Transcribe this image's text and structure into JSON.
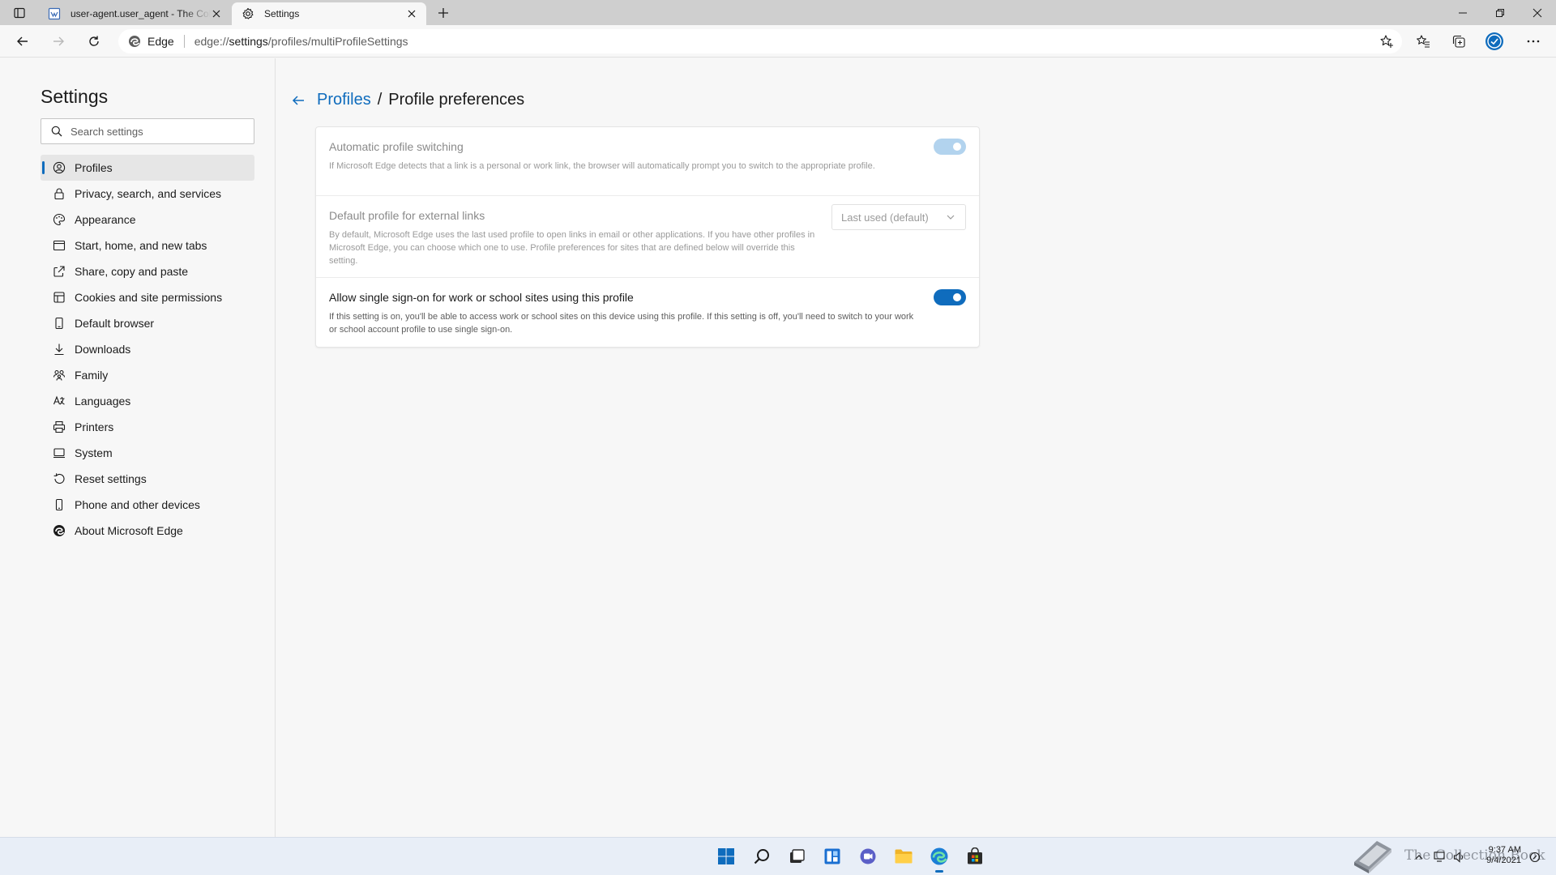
{
  "browser": {
    "tabs": [
      {
        "title": "user-agent.user_agent - The Collection Book",
        "icon": "web-document-icon",
        "active": false
      },
      {
        "title": "Settings",
        "icon": "gear-icon",
        "active": true
      }
    ],
    "window_controls": [
      "minimize-icon",
      "restore-icon",
      "close-icon"
    ],
    "toolbar": {
      "site_label": "Edge",
      "url_prefix": "edge://",
      "url_host": "settings",
      "url_path": "/profiles/multiProfileSettings"
    }
  },
  "sidebar": {
    "title": "Settings",
    "search_placeholder": "Search settings",
    "items": [
      {
        "label": "Profiles",
        "icon": "profile-icon",
        "active": true
      },
      {
        "label": "Privacy, search, and services",
        "icon": "lock-icon"
      },
      {
        "label": "Appearance",
        "icon": "appearance-icon"
      },
      {
        "label": "Start, home, and new tabs",
        "icon": "power-icon"
      },
      {
        "label": "Share, copy and paste",
        "icon": "share-icon"
      },
      {
        "label": "Cookies and site permissions",
        "icon": "cookies-icon"
      },
      {
        "label": "Default browser",
        "icon": "default-browser-icon"
      },
      {
        "label": "Downloads",
        "icon": "download-icon"
      },
      {
        "label": "Family",
        "icon": "family-icon"
      },
      {
        "label": "Languages",
        "icon": "languages-icon"
      },
      {
        "label": "Printers",
        "icon": "printer-icon"
      },
      {
        "label": "System",
        "icon": "system-icon"
      },
      {
        "label": "Reset settings",
        "icon": "reset-icon"
      },
      {
        "label": "Phone and other devices",
        "icon": "phone-icon"
      },
      {
        "label": "About Microsoft Edge",
        "icon": "edge-logo-icon"
      }
    ]
  },
  "main": {
    "breadcrumb_parent": "Profiles",
    "breadcrumb_separator": "/",
    "breadcrumb_current": "Profile preferences",
    "settings": [
      {
        "title": "Automatic profile switching",
        "description": "If Microsoft Edge detects that a link is a personal or work link, the browser will automatically prompt you to switch to the appropriate profile.",
        "control": "toggle",
        "on": true,
        "disabled": true
      },
      {
        "title": "Default profile for external links",
        "description": "By default, Microsoft Edge uses the last used profile to open links in email or other applications. If you have other profiles in Microsoft Edge, you can choose which one to use. Profile preferences for sites that are defined below will override this setting.",
        "control": "dropdown",
        "selected": "Last used (default)",
        "disabled": true
      },
      {
        "title": "Allow single sign-on for work or school sites using this profile",
        "description": "If this setting is on, you'll be able to access work or school sites on this device using this profile. If this setting is off, you'll need to switch to your work or school account profile to use single sign-on.",
        "control": "toggle",
        "on": true,
        "disabled": false
      }
    ]
  },
  "taskbar": {
    "apps": [
      "start-icon",
      "search-icon",
      "task-view-icon",
      "widgets-icon",
      "chat-icon",
      "file-explorer-icon",
      "edge-icon",
      "store-icon"
    ],
    "watermark_text": "The Collection Book",
    "time": "9:37 AM",
    "date": "9/4/2021"
  },
  "colors": {
    "accent": "#0f6cbd",
    "toggle_disabled": "#b2d3ee",
    "tabstrip": "#cfcfcf",
    "background": "#f7f7f7"
  }
}
